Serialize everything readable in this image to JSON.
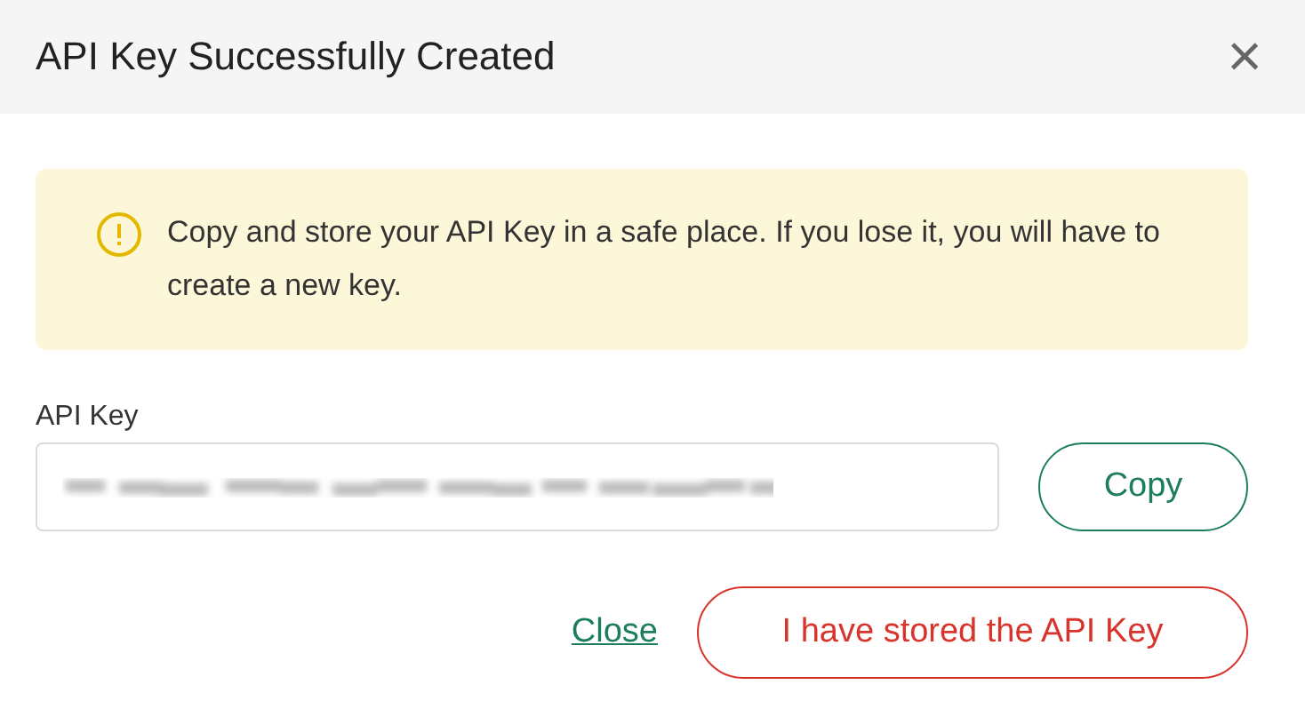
{
  "dialog": {
    "title": "API Key Successfully Created",
    "close_icon": "×"
  },
  "alert": {
    "kind": "warning",
    "message": "Copy and store your API Key in a safe place. If you lose it, you will have to create a new key."
  },
  "api_key_field": {
    "label": "API Key",
    "value_redacted": true
  },
  "copy_button": "Copy",
  "actions": [
    {
      "kind": "link",
      "label": "Close"
    },
    {
      "kind": "danger",
      "label": "I have stored the API Key"
    }
  ]
}
